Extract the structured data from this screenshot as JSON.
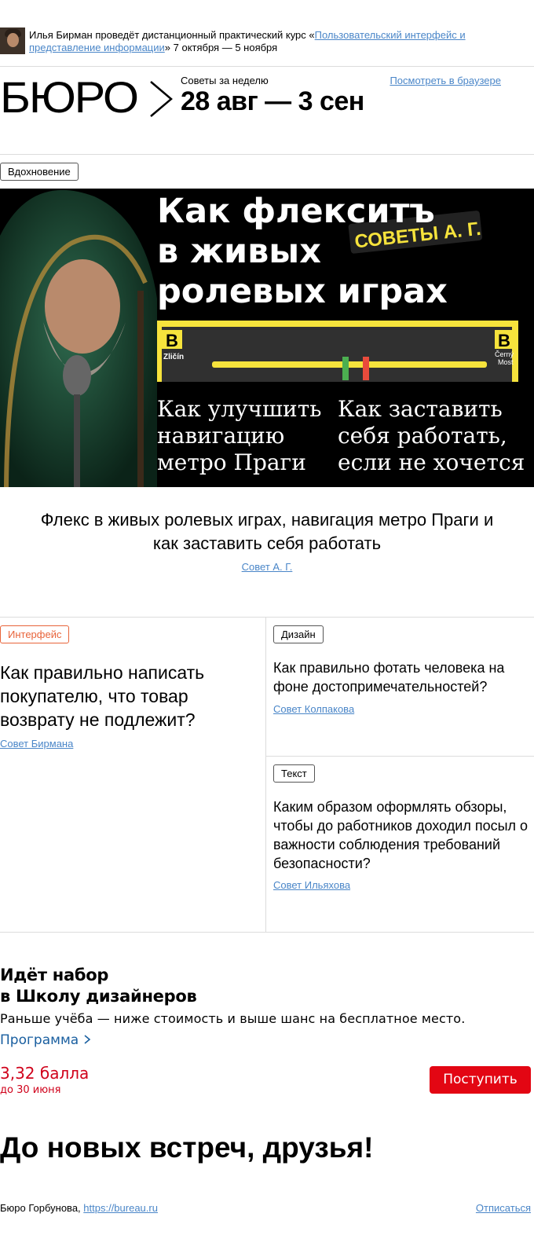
{
  "promo": {
    "text_before": "Илья Бирман проведёт дистанционный практический курс «",
    "course_link": "Пользовательский интерфейс и представление информации",
    "text_after": "» 7 октября — 5 ноября"
  },
  "header": {
    "logo": "БЮРО",
    "week_label": "Советы за неделю",
    "week_range": "28 авг — 3 сен",
    "browser_link": "Посмотреть в браузере"
  },
  "main": {
    "tag": "Вдохновение",
    "hero": {
      "headline_lines": [
        "Как флекситъ",
        "в живых",
        "ролевых играх"
      ],
      "sticker": "СОВЕТЫ А. Г.",
      "metro_left_letter": "B",
      "metro_left_station": "Zličín",
      "metro_right_letter": "B",
      "metro_right_station_1": "Černý",
      "metro_right_station_2": "Most",
      "left_bottom_lines": [
        "Как улучшить",
        "навигацию",
        "метро Праги"
      ],
      "right_bottom_lines": [
        "Как заставить",
        "себя работать,",
        "если не хочется"
      ]
    },
    "title": "Флекс в живых ролевых играх, навигация метро Праги и как заставить себя работать",
    "link": "Совет А. Г."
  },
  "cards": [
    {
      "tag": "Интерфейс",
      "title": "Как правильно написать покупателю, что товар возврату не подлежит?",
      "link": "Совет Бирмана"
    },
    {
      "tag": "Дизайн",
      "title": "Как правильно фотать человека на фоне достопримечательностей?",
      "link": "Совет Колпакова"
    },
    {
      "tag": "Текст",
      "title": "Каким образом оформлять обзоры, чтобы до работников доходил посыл о важности соблюдения требований безопасности?",
      "link": "Совет Ильяхова"
    }
  ],
  "school": {
    "title_line1": "Идёт набор",
    "title_line2": "в Школу дизайнеров",
    "desc": "Раньше учёба — ниже стоимость и выше шанс на бесплатное место.",
    "program": "Программа",
    "score": "3,32 балла",
    "deadline": "до 30 июня",
    "apply": "Поступить",
    "colors": {
      "accent_red": "#e30613",
      "link_blue": "#1a5fa0"
    }
  },
  "goodbye": "До новых встреч, друзья!",
  "footer": {
    "company": "Бюро Горбунова,",
    "site": "https://bureau.ru",
    "unsubscribe": "Отписаться"
  }
}
